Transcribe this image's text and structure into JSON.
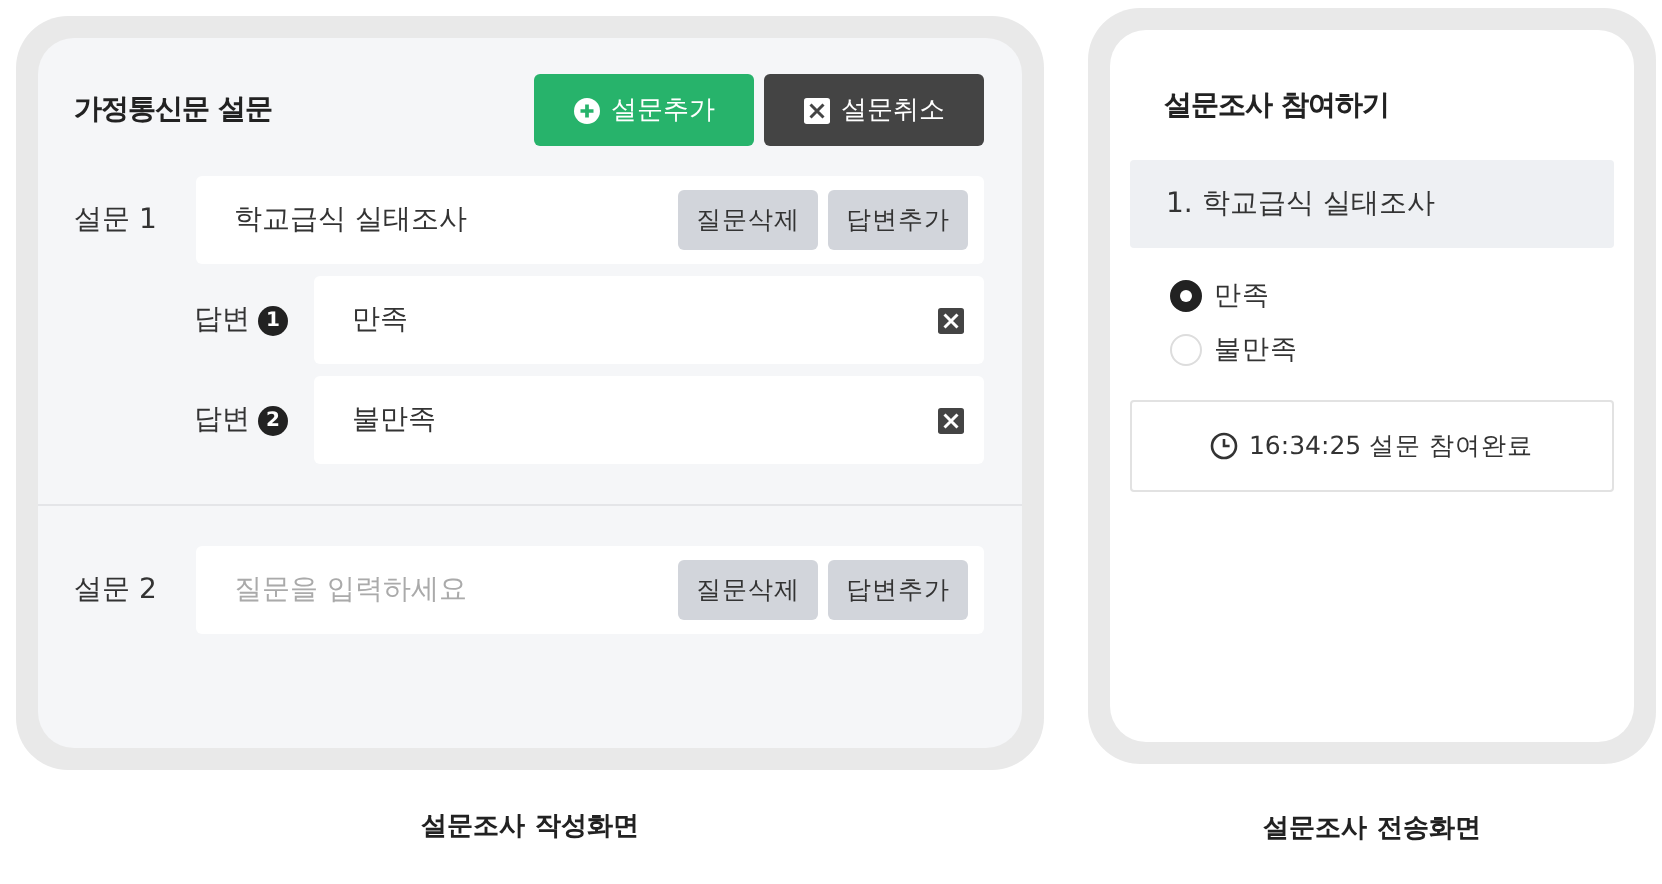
{
  "editor": {
    "title": "가정통신문 설문",
    "buttons": [
      {
        "kind": "add",
        "label": "설문추가"
      },
      {
        "kind": "cancel",
        "label": "설문취소"
      }
    ],
    "questions": [
      {
        "label": "설문 1",
        "value": "학교급식 실태조사",
        "actions": [
          "질문삭제",
          "답변추가"
        ],
        "answers": [
          {
            "label": "답변",
            "number": "1",
            "value": "만족"
          },
          {
            "label": "답변",
            "number": "2",
            "value": "불만족"
          }
        ]
      },
      {
        "label": "설문 2",
        "placeholder": "질문을 입력하세요",
        "actions": [
          "질문삭제",
          "답변추가"
        ]
      }
    ],
    "caption": "설문조사 작성화면"
  },
  "preview": {
    "title": "설문조사 참여하기",
    "question": "1. 학교급식 실태조사",
    "options": [
      {
        "label": "만족",
        "selected": true
      },
      {
        "label": "불만족",
        "selected": false
      }
    ],
    "status": "16:34:25 설문 참여완료",
    "caption": "설문조사 전송화면"
  }
}
